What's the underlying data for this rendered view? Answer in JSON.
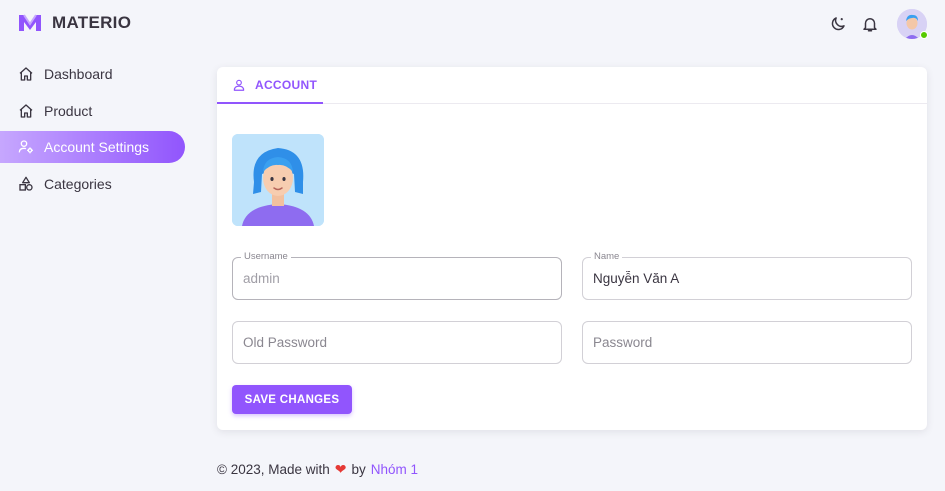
{
  "app": {
    "title": "MATERIO",
    "brand_color": "#9155fd"
  },
  "topbar": {
    "theme_icon": "moon-icon",
    "notification_icon": "bell-icon",
    "avatar_status_color": "#56ca00"
  },
  "sidebar": {
    "items": [
      {
        "label": "Dashboard",
        "icon": "home-icon",
        "active": false
      },
      {
        "label": "Product",
        "icon": "home-icon",
        "active": false
      },
      {
        "label": "Account Settings",
        "icon": "account-cog-icon",
        "active": true
      },
      {
        "label": "Categories",
        "icon": "shapes-icon",
        "active": false
      }
    ]
  },
  "card": {
    "tab_label": "ACCOUNT",
    "tab_icon": "account-icon",
    "form": {
      "username_label": "Username",
      "username_value": "admin",
      "name_label": "Name",
      "name_value": "Nguyễn Văn A",
      "old_password_placeholder": "Old Password",
      "password_placeholder": "Password",
      "save_label": "SAVE CHANGES"
    }
  },
  "footer": {
    "prefix": "© 2023, Made with",
    "heart": "❤",
    "by": "by",
    "link": "Nhóm 1"
  }
}
